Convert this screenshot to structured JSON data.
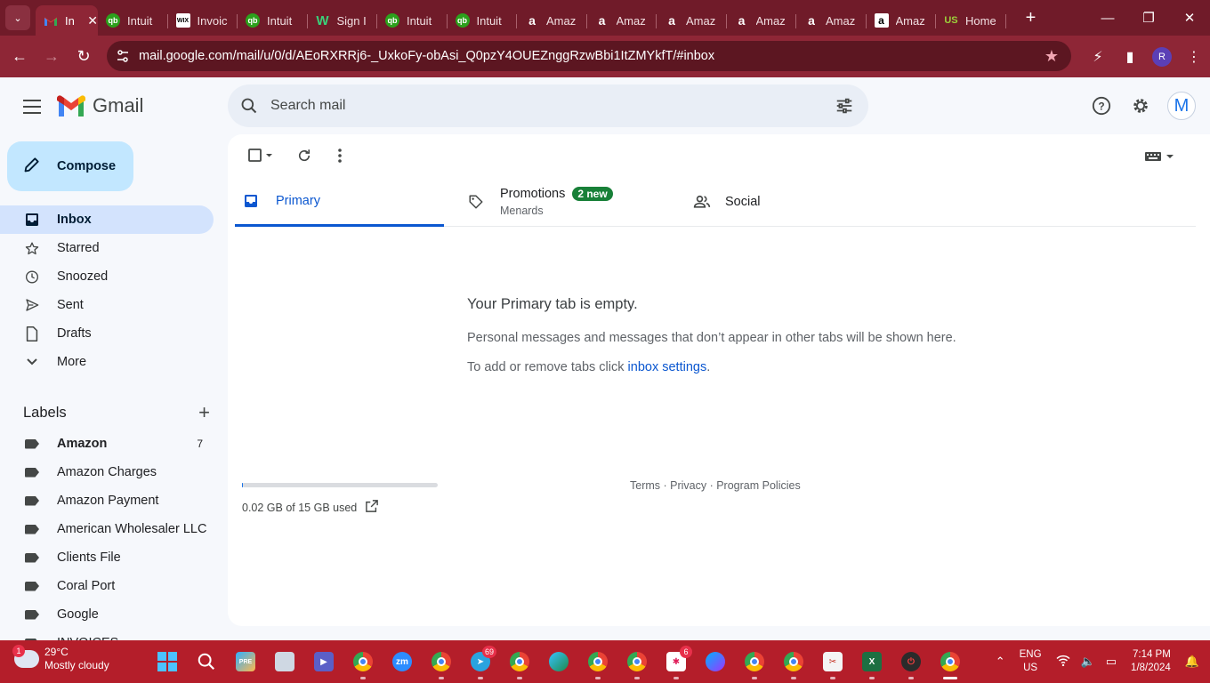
{
  "browser": {
    "tabs": [
      {
        "title": "In",
        "favicon": "gmail",
        "active": true
      },
      {
        "title": "Intuit",
        "favicon": "quickbooks"
      },
      {
        "title": "Invoic",
        "favicon": "wix"
      },
      {
        "title": "Intuit",
        "favicon": "quickbooks"
      },
      {
        "title": "Sign I",
        "favicon": "sign"
      },
      {
        "title": "Intuit",
        "favicon": "quickbooks"
      },
      {
        "title": "Intuit",
        "favicon": "quickbooks"
      },
      {
        "title": "Amaz",
        "favicon": "amazon"
      },
      {
        "title": "Amaz",
        "favicon": "amazon"
      },
      {
        "title": "Amaz",
        "favicon": "amazon"
      },
      {
        "title": "Amaz",
        "favicon": "amazon"
      },
      {
        "title": "Amaz",
        "favicon": "amazon"
      },
      {
        "title": "Amaz",
        "favicon": "amazon-white"
      },
      {
        "title": "Home",
        "favicon": "us"
      }
    ],
    "url": "mail.google.com/mail/u/0/d/AEoRXRRj6-_UxkoFy-obAsi_Q0pzY4OUEZnggRzwBbi1ItZMYkfT/#inbox",
    "profile_initial": "R"
  },
  "gmail": {
    "logo_text": "Gmail",
    "search_placeholder": "Search mail",
    "avatar_initial": "M",
    "compose_label": "Compose",
    "nav": [
      {
        "label": "Inbox",
        "icon": "inbox-icon",
        "active": true
      },
      {
        "label": "Starred",
        "icon": "star-icon"
      },
      {
        "label": "Snoozed",
        "icon": "clock-icon"
      },
      {
        "label": "Sent",
        "icon": "send-icon"
      },
      {
        "label": "Drafts",
        "icon": "draft-icon"
      },
      {
        "label": "More",
        "icon": "chevron-down-icon"
      }
    ],
    "labels_title": "Labels",
    "labels": [
      {
        "name": "Amazon",
        "count": "7",
        "bold": true
      },
      {
        "name": "Amazon Charges"
      },
      {
        "name": "Amazon Payment"
      },
      {
        "name": "American Wholesaler LLC"
      },
      {
        "name": "Clients File"
      },
      {
        "name": "Coral Port"
      },
      {
        "name": "Google"
      },
      {
        "name": "INVOICES"
      }
    ],
    "tabs": {
      "primary": "Primary",
      "promotions": "Promotions",
      "promotions_badge": "2 new",
      "promotions_sub": "Menards",
      "social": "Social"
    },
    "empty": {
      "title": "Your Primary tab is empty.",
      "body": "Personal messages and messages that don’t appear in other tabs will be shown here.",
      "tip_prefix": "To add or remove tabs click ",
      "tip_link": "inbox settings",
      "tip_suffix": "."
    },
    "storage": {
      "text": "0.02 GB of 15 GB used",
      "fraction": 0.0013
    },
    "footer": "Terms · Privacy · Program Policies"
  },
  "taskbar": {
    "weather_alert": "1",
    "temperature": "29°C",
    "condition": "Mostly cloudy",
    "zoom_label": "zm",
    "telegram_badge": "69",
    "slack_badge": "6",
    "lang_top": "ENG",
    "lang_bottom": "US",
    "time": "7:14 PM",
    "date": "1/8/2024"
  },
  "colors": {
    "chrome_frame": "#701b29",
    "chrome_toolbar": "#8e2636",
    "taskbar": "#b41e2a",
    "compose": "#c2e7ff",
    "active_nav": "#d3e3fd",
    "accent": "#0b57d0",
    "badge_green": "#188038"
  }
}
